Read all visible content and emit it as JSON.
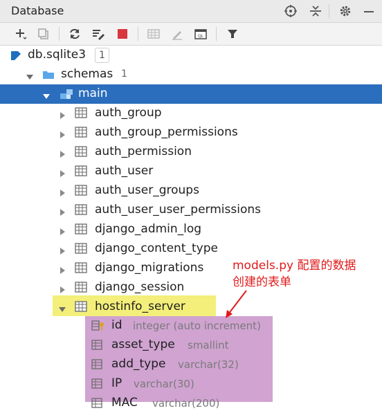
{
  "panel": {
    "title": "Database"
  },
  "tree": {
    "root": {
      "label": "db.sqlite3",
      "badge": "1"
    },
    "schemas": {
      "label": "schemas",
      "count": "1"
    },
    "main": {
      "label": "main"
    },
    "tables": [
      "auth_group",
      "auth_group_permissions",
      "auth_permission",
      "auth_user",
      "auth_user_groups",
      "auth_user_user_permissions",
      "django_admin_log",
      "django_content_type",
      "django_migrations",
      "django_session",
      "hostinfo_server"
    ],
    "columns": [
      {
        "name": "id",
        "type": "integer (auto increment)"
      },
      {
        "name": "asset_type",
        "type": "smallint"
      },
      {
        "name": "add_type",
        "type": "varchar(32)"
      },
      {
        "name": "IP",
        "type": "varchar(30)"
      },
      {
        "name": "MAC",
        "type": "varchar(200)"
      }
    ]
  },
  "annotation": {
    "line1": "models.py 配置的数据",
    "line2": "创建的表单"
  },
  "colors": {
    "selection": "#2a6ebd",
    "highlight_yellow": "#f3ef7a",
    "highlight_purple": "#d0a3d1",
    "annotation_red": "#e01b1b"
  }
}
